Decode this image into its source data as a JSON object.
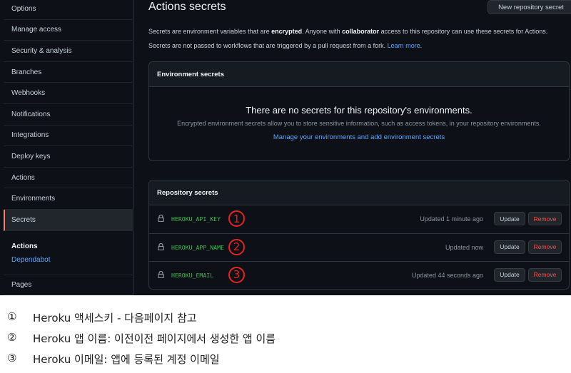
{
  "sidebar": {
    "items": [
      {
        "label": "Options",
        "active": false
      },
      {
        "label": "Manage access",
        "active": false
      },
      {
        "label": "Security & analysis",
        "active": false
      },
      {
        "label": "Branches",
        "active": false
      },
      {
        "label": "Webhooks",
        "active": false
      },
      {
        "label": "Notifications",
        "active": false
      },
      {
        "label": "Integrations",
        "active": false
      },
      {
        "label": "Deploy keys",
        "active": false
      },
      {
        "label": "Actions",
        "active": false
      },
      {
        "label": "Environments",
        "active": false
      },
      {
        "label": "Secrets",
        "active": true
      }
    ],
    "section_heading": "Actions",
    "section_link": "Dependabot",
    "bottom_item": "Pages"
  },
  "header": {
    "title": "Actions secrets",
    "new_button": "New repository secret"
  },
  "description": {
    "line1_a": "Secrets are environment variables that are ",
    "line1_b": "encrypted",
    "line1_c": ". Anyone with ",
    "line1_d": "collaborator",
    "line1_e": " access to this repository can use these secrets for Actions.",
    "line2_a": "Secrets are not passed to workflows that are triggered by a pull request from a fork. ",
    "line2_link": "Learn more",
    "line2_end": "."
  },
  "environment_secrets": {
    "heading": "Environment secrets",
    "empty_title": "There are no secrets for this repository's environments.",
    "empty_subtitle": "Encrypted environment secrets allow you to store sensitive information, such as access tokens, in your repository environments.",
    "manage_link": "Manage your environments and add environment secrets"
  },
  "repository_secrets": {
    "heading": "Repository secrets",
    "rows": [
      {
        "name": "HEROKU_API_KEY",
        "marker": "1",
        "updated": "Updated 1 minute ago",
        "update_label": "Update",
        "remove_label": "Remove"
      },
      {
        "name": "HEROKU_APP_NAME",
        "marker": "2",
        "updated": "Updated now",
        "update_label": "Update",
        "remove_label": "Remove"
      },
      {
        "name": "HEROKU_EMAIL",
        "marker": "3",
        "updated": "Updated 44 seconds ago",
        "update_label": "Update",
        "remove_label": "Remove"
      }
    ]
  },
  "notes": [
    {
      "num": "①",
      "text": "Heroku 액세스키 - 다음페이지 참고"
    },
    {
      "num": "②",
      "text": "Heroku 앱 이름: 이전이전 페이지에서 생성한 앱 이름"
    },
    {
      "num": "③",
      "text": "Heroku 이메일: 앱에 등록된 계정 이메일"
    }
  ],
  "colors": {
    "background": "#0d1117",
    "secret_name": "#3fb950",
    "remove": "#f85149",
    "link": "#58a6ff",
    "marker": "#e5241f"
  }
}
